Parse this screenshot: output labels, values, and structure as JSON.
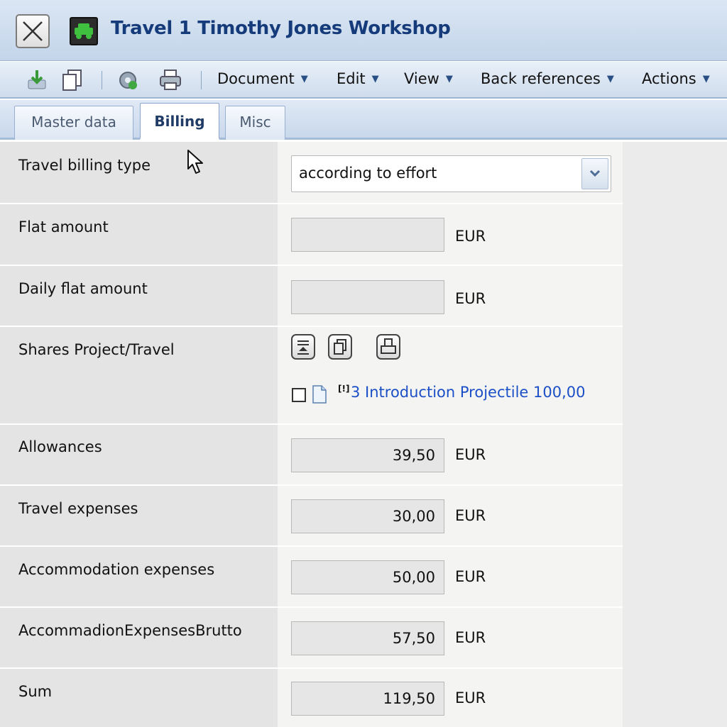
{
  "window": {
    "title": "Travel 1 Timothy Jones Workshop"
  },
  "toolbar": {
    "menus": [
      {
        "label": "Document"
      },
      {
        "label": "Edit"
      },
      {
        "label": "View"
      },
      {
        "label": "Back references"
      },
      {
        "label": "Actions"
      }
    ]
  },
  "tabs": [
    {
      "label": "Master data",
      "active": false
    },
    {
      "label": "Billing",
      "active": true
    },
    {
      "label": "Misc",
      "active": false
    }
  ],
  "form": {
    "travel_billing_type": {
      "label": "Travel billing type",
      "value": "according to effort"
    },
    "flat_amount": {
      "label": "Flat amount",
      "value": "",
      "unit": "EUR"
    },
    "daily_flat_amount": {
      "label": "Daily flat amount",
      "value": "",
      "unit": "EUR"
    },
    "shares": {
      "label": "Shares Project/Travel",
      "flag": "[!]",
      "item": "3 Introduction Projectile 100,00"
    },
    "allowances": {
      "label": "Allowances",
      "value": "39,50",
      "unit": "EUR"
    },
    "travel_expenses": {
      "label": "Travel expenses",
      "value": "30,00",
      "unit": "EUR"
    },
    "accommodation_expenses": {
      "label": "Accommodation expenses",
      "value": "50,00",
      "unit": "EUR"
    },
    "accommodation_brutto": {
      "label": "AccommadionExpensesBrutto",
      "value": "57,50",
      "unit": "EUR"
    },
    "sum": {
      "label": "Sum",
      "value": "119,50",
      "unit": "EUR"
    }
  }
}
